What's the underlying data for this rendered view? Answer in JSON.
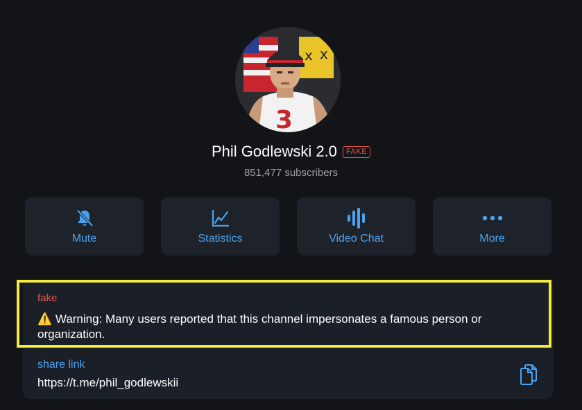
{
  "channel": {
    "name": "Phil Godlewski 2.0",
    "badge": "FAKE",
    "subscribers": "851,477 subscribers"
  },
  "actions": [
    {
      "label": "Mute",
      "icon": "bell-slash-icon"
    },
    {
      "label": "Statistics",
      "icon": "chart-line-icon"
    },
    {
      "label": "Video Chat",
      "icon": "audio-wave-icon"
    },
    {
      "label": "More",
      "icon": "ellipsis-icon"
    }
  ],
  "info": {
    "fake_label": "fake",
    "warning_icon": "⚠️",
    "warning": "Warning: Many users reported that this channel impersonates a famous person or organization.",
    "share_label": "share link",
    "share_url": "https://t.me/phil_godlewskii"
  },
  "colors": {
    "background": "#121418",
    "accent": "#4aa3f0",
    "fake": "#e05a50",
    "highlight": "#f5ec3a"
  }
}
